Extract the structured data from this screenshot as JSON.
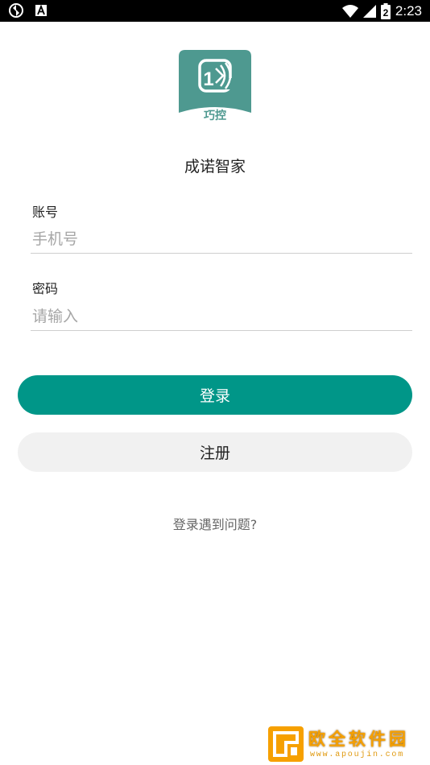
{
  "status_bar": {
    "time": "2:23",
    "battery_level_label": "2"
  },
  "app": {
    "logo_text": "巧控",
    "name": "成诺智家"
  },
  "form": {
    "account_label": "账号",
    "account_placeholder": "手机号",
    "account_value": "",
    "password_label": "密码",
    "password_placeholder": "请输入",
    "password_value": ""
  },
  "buttons": {
    "login_label": "登录",
    "register_label": "注册"
  },
  "help_link_label": "登录遇到问题?",
  "watermark": {
    "title": "欧全软件园",
    "url": "www.apoujin.com"
  },
  "colors": {
    "accent": "#009688",
    "logo": "#4e9990",
    "secondary_button": "#f1f1f1",
    "status_bar": "#000000",
    "watermark": "#f6a000"
  }
}
